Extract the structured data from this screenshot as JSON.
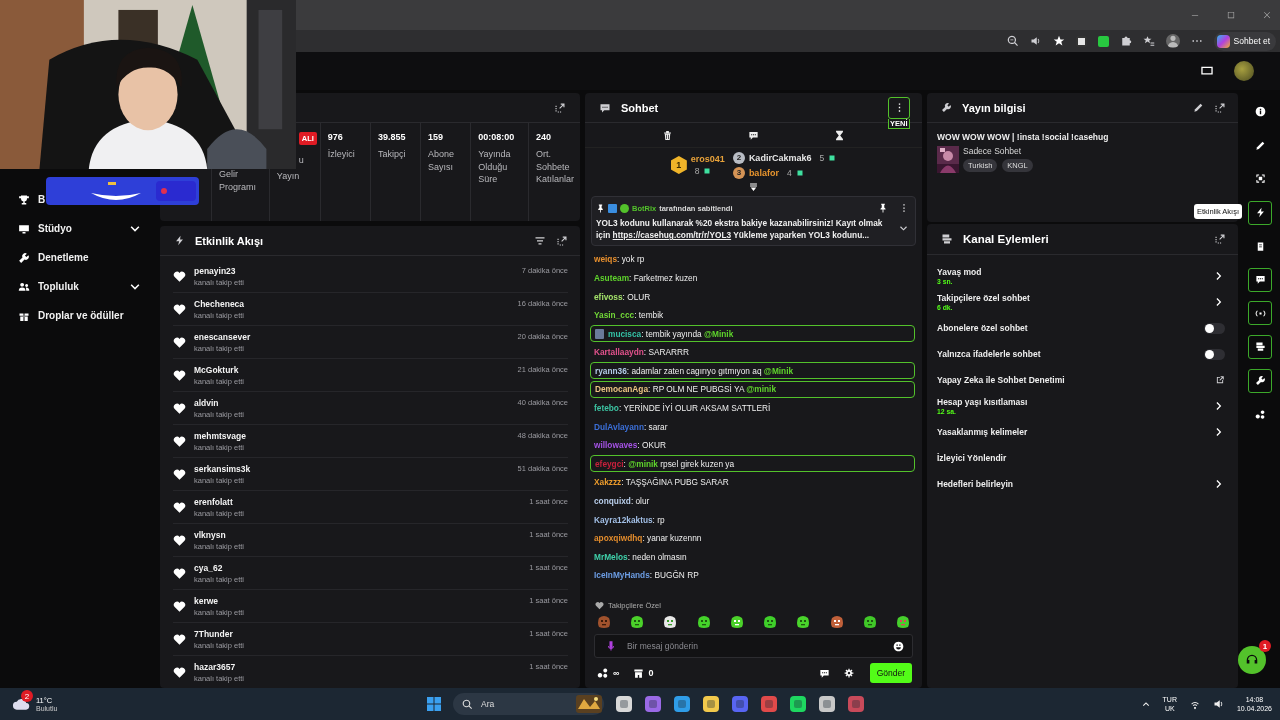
{
  "browser": {
    "copilot_label": "Sohbet et"
  },
  "sidebar": {
    "items": [
      {
        "label": "B",
        "expandable": false
      },
      {
        "label": "Stüdyo",
        "expandable": true
      },
      {
        "label": "Denetleme",
        "expandable": false
      },
      {
        "label": "Topluluk",
        "expandable": true
      },
      {
        "label": "Droplar ve ödüller",
        "expandable": false
      }
    ]
  },
  "stats": {
    "columns": [
      {
        "label": "Gelir Programı"
      },
      {
        "badge": "ALI",
        "label": "u\nYayın"
      },
      {
        "value": "976",
        "label": "İzleyici"
      },
      {
        "value": "39.855",
        "label": "Takipçi"
      },
      {
        "value": "159",
        "label": "Abone Sayısı"
      },
      {
        "value": "00:08:00",
        "label": "Yayında Olduğu Süre"
      },
      {
        "value": "240",
        "label": "Ort. Sohbete Katılanlar"
      }
    ]
  },
  "activity": {
    "title": "Etkinlik Akışı",
    "events": [
      {
        "user": "penayin23",
        "action": "kanalı takip etti",
        "time": "7 dakika önce"
      },
      {
        "user": "Checheneca",
        "action": "kanalı takip etti",
        "time": "16 dakika önce"
      },
      {
        "user": "enescansever",
        "action": "kanalı takip etti",
        "time": "20 dakika önce"
      },
      {
        "user": "McGokturk",
        "action": "kanalı takip etti",
        "time": "21 dakika önce"
      },
      {
        "user": "aldvin",
        "action": "kanalı takip etti",
        "time": "40 dakika önce"
      },
      {
        "user": "mehmtsvage",
        "action": "kanalı takip etti",
        "time": "48 dakika önce"
      },
      {
        "user": "serkansims3k",
        "action": "kanalı takip etti",
        "time": "51 dakika önce"
      },
      {
        "user": "erenfolatt",
        "action": "kanalı takip etti",
        "time": "1 saat önce"
      },
      {
        "user": "vlknysn",
        "action": "kanalı takip etti",
        "time": "1 saat önce"
      },
      {
        "user": "cya_62",
        "action": "kanalı takip etti",
        "time": "1 saat önce"
      },
      {
        "user": "kerwe",
        "action": "kanalı takip etti",
        "time": "1 saat önce"
      },
      {
        "user": "7Thunder",
        "action": "kanalı takip etti",
        "time": "1 saat önce"
      },
      {
        "user": "hazar3657",
        "action": "kanalı takip etti",
        "time": "1 saat önce"
      }
    ]
  },
  "chat": {
    "title": "Sohbet",
    "new_badge": "YENİ",
    "leaders": [
      {
        "rank": "1",
        "name": "eros041",
        "count": "8",
        "color": "#e8a23a"
      },
      {
        "rank": "2",
        "name": "KadirCakmak6",
        "count": "5",
        "color": "#e6e6e6"
      },
      {
        "rank": "3",
        "name": "balafor",
        "count": "4",
        "color": "#e8952e"
      }
    ],
    "pinned": {
      "author": "BotRix",
      "note": "tarafından sabitlendi",
      "text_before": "YOL3 kodunu kullanarak %20 ekstra bakiye kazanabilirsiniz! Kayıt olmak için ",
      "link": "https://casehug.com/tr/r/YOL3",
      "text_after": " Yükleme yaparken YOL3 kodunu..."
    },
    "messages": [
      {
        "user": "weiqs",
        "color": "#e8902e",
        "highlighted": false,
        "badge": false,
        "segments": [
          {
            "kind": "plain",
            "text": "yok rp"
          }
        ]
      },
      {
        "user": "Asuteam",
        "color": "#5fd42c",
        "highlighted": false,
        "badge": false,
        "segments": [
          {
            "kind": "plain",
            "text": "Farketmez kuzen"
          }
        ]
      },
      {
        "user": "efivoss",
        "color": "#a3e26a",
        "highlighted": false,
        "badge": false,
        "segments": [
          {
            "kind": "plain",
            "text": "OLUR"
          }
        ]
      },
      {
        "user": "Yasin_ccc",
        "color": "#72d838",
        "highlighted": false,
        "badge": false,
        "segments": [
          {
            "kind": "plain",
            "text": "tembik"
          }
        ]
      },
      {
        "user": "mucisca",
        "color": "#34c2a6",
        "highlighted": true,
        "badge": true,
        "segments": [
          {
            "kind": "plain",
            "text": "tembik yayında "
          },
          {
            "kind": "mention",
            "text": "@Minik"
          }
        ]
      },
      {
        "user": "Kartallaaydn",
        "color": "#e2528c",
        "highlighted": false,
        "badge": false,
        "segments": [
          {
            "kind": "plain",
            "text": "SARARRR"
          }
        ]
      },
      {
        "user": "ryann36",
        "color": "#b4cdea",
        "highlighted": true,
        "badge": false,
        "segments": [
          {
            "kind": "plain",
            "text": "adamlar zaten cagırıyo gıtmıyon aq "
          },
          {
            "kind": "mention",
            "text": "@Minik"
          }
        ]
      },
      {
        "user": "DemocanAga",
        "color": "#ecc583",
        "highlighted": true,
        "badge": false,
        "segments": [
          {
            "kind": "plain",
            "text": "RP OLM NE PUBGSİ YA "
          },
          {
            "kind": "mention",
            "text": "@minik"
          }
        ]
      },
      {
        "user": "fetebo",
        "color": "#3cc3a2",
        "highlighted": false,
        "badge": false,
        "segments": [
          {
            "kind": "plain",
            "text": "YERİNDE İYİ OLUR AKSAM SATTLERİ"
          }
        ]
      },
      {
        "user": "DulAvlayann",
        "color": "#3b6fd8",
        "highlighted": false,
        "badge": false,
        "segments": [
          {
            "kind": "plain",
            "text": "sarar"
          }
        ]
      },
      {
        "user": "willowaves",
        "color": "#a552e6",
        "highlighted": false,
        "badge": false,
        "segments": [
          {
            "kind": "plain",
            "text": "OKUR"
          }
        ]
      },
      {
        "user": "efeygci",
        "color": "#c8203c",
        "highlighted": true,
        "badge": false,
        "segments": [
          {
            "kind": "mention",
            "text": "@minik"
          },
          {
            "kind": "plain",
            "text": " rpsel girek kuzen ya"
          }
        ]
      },
      {
        "user": "Xakzzz",
        "color": "#eb9b2c",
        "highlighted": false,
        "badge": false,
        "segments": [
          {
            "kind": "plain",
            "text": "TAŞŞAĞINA PUBG SARAR"
          }
        ]
      },
      {
        "user": "conquixd",
        "color": "#b8cdea",
        "highlighted": false,
        "badge": false,
        "segments": [
          {
            "kind": "plain",
            "text": "olur"
          }
        ]
      },
      {
        "user": "Kayra12kaktus",
        "color": "#a2bfe6",
        "highlighted": false,
        "badge": false,
        "segments": [
          {
            "kind": "plain",
            "text": "rp"
          }
        ]
      },
      {
        "user": "apoxqiwdhq",
        "color": "#e38c2c",
        "highlighted": false,
        "badge": false,
        "segments": [
          {
            "kind": "plain",
            "text": "yanar kuzennn"
          }
        ]
      },
      {
        "user": "MrMelos",
        "color": "#3fd2ab",
        "highlighted": false,
        "badge": false,
        "segments": [
          {
            "kind": "plain",
            "text": "neden olmasın"
          }
        ]
      },
      {
        "user": "IceInMyHands",
        "color": "#6c9de4",
        "highlighted": false,
        "badge": false,
        "segments": [
          {
            "kind": "plain",
            "text": "BUGĞN RP"
          }
        ]
      }
    ],
    "separator": ":",
    "emote_label": "Takipçilere Özel",
    "input": {
      "placeholder": "Bir mesaj gönderin"
    },
    "points": "∞",
    "store_count": "0",
    "send": "Gönder"
  },
  "stream_info": {
    "title": "Yayın bilgisi",
    "stream_title": "WOW WOW WOW | !insta !social !casehug",
    "category": "Sadece Sohbet",
    "tags": [
      "Turkish",
      "KNGL"
    ]
  },
  "channel_actions": {
    "title": "Kanal Eylemleri",
    "items": [
      {
        "kind": "arrow",
        "label": "Yavaş mod",
        "value": "3 sn."
      },
      {
        "kind": "arrow",
        "label": "Takipçilere özel sohbet",
        "value": "6 dk."
      },
      {
        "kind": "toggle",
        "label": "Abonelere özel sohbet",
        "on": false
      },
      {
        "kind": "toggle",
        "label": "Yalnızca ifadelerle sohbet",
        "on": false
      },
      {
        "kind": "external",
        "label": "Yapay Zeka ile Sohbet Denetimi"
      },
      {
        "kind": "arrow",
        "label": "Hesap yaşı kısıtlaması",
        "value": "12 sa."
      },
      {
        "kind": "arrow",
        "label": "Yasaklanmış kelimeler"
      },
      {
        "kind": "plain",
        "label": "İzleyici Yönlendir"
      },
      {
        "kind": "arrow",
        "label": "Hedefleri belirleyin"
      }
    ]
  },
  "rail": {
    "tooltip": "Etkinlik Akışı",
    "items": [
      {
        "active": false
      },
      {
        "active": false
      },
      {
        "active": false
      },
      {
        "active": true
      },
      {
        "active": false
      },
      {
        "active": true
      },
      {
        "active": true
      },
      {
        "active": true
      },
      {
        "active": true
      },
      {
        "active": false
      }
    ]
  },
  "help": {
    "badge": "1"
  },
  "taskbar": {
    "weather_badge": "2",
    "temperature": "11°C",
    "condition": "Bulutlu",
    "search_placeholder": "Ara",
    "language": "TUR",
    "layout": "UK",
    "time": "14:08",
    "date": "10.04.2026"
  }
}
